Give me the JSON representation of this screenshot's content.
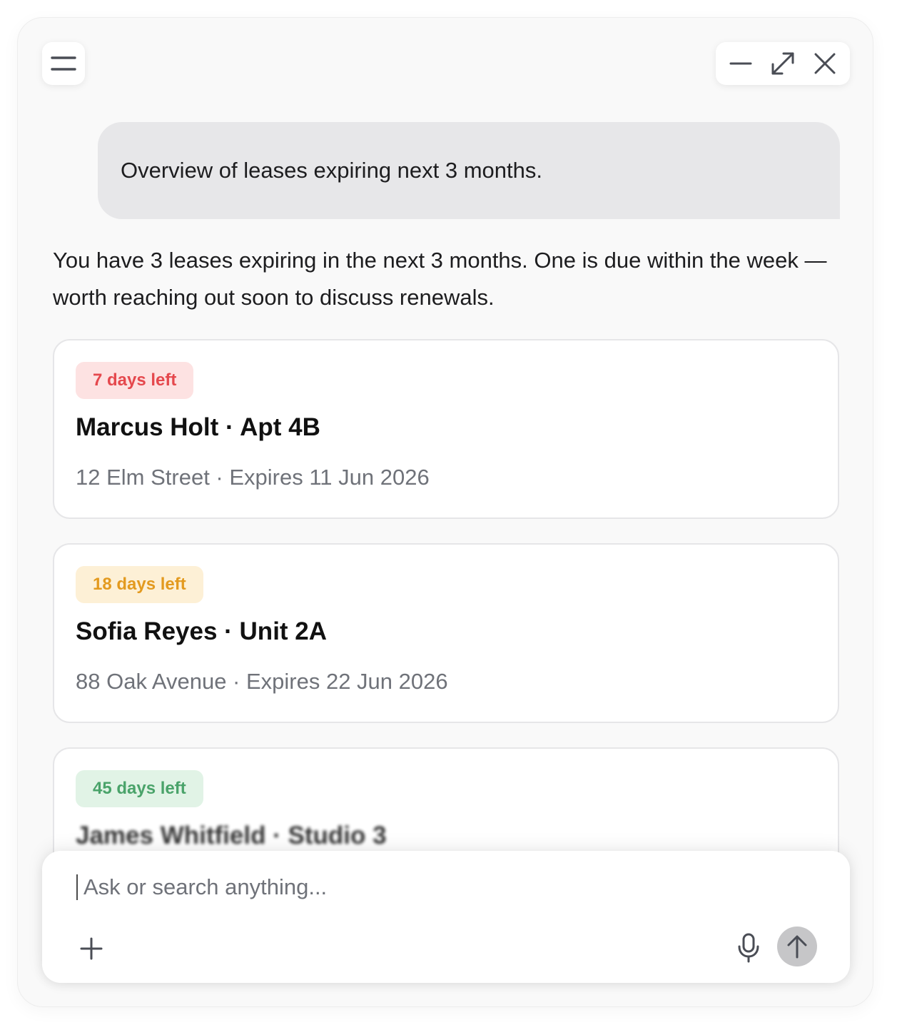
{
  "window": {
    "menu_icon": "hamburger-menu-icon",
    "controls": [
      "minimize-icon",
      "expand-icon",
      "close-icon"
    ]
  },
  "conversation": {
    "user_message": "Overview of leases expiring next 3 months.",
    "assistant_message": "You have 3 leases expiring in the next 3 months. One is due within the week — worth reaching out soon to discuss renewals."
  },
  "leases": [
    {
      "badge": "7 days left",
      "badge_text_color": "#e5484d",
      "badge_bg_color": "#fde2e2",
      "title": "Marcus Holt · Apt 4B",
      "details": "12 Elm Street · Expires 11 Jun 2026"
    },
    {
      "badge": "18 days left",
      "badge_text_color": "#e39a1f",
      "badge_bg_color": "#fdf0d6",
      "title": "Sofia Reyes · Unit 2A",
      "details": "88 Oak Avenue · Expires 22 Jun 2026"
    },
    {
      "badge": "45 days left",
      "badge_text_color": "#4aa36a",
      "badge_bg_color": "#e1f3e6",
      "title": "James Whitfield · Studio 3"
    }
  ],
  "composer": {
    "placeholder": "Ask or search anything...",
    "value": "",
    "icons": [
      "plus-icon",
      "microphone-icon",
      "arrow-up-icon"
    ]
  },
  "colors": {
    "panel_background": "#f9f9f9",
    "user_bubble": "#e7e7e9",
    "send_button": "#c6c6c8"
  }
}
